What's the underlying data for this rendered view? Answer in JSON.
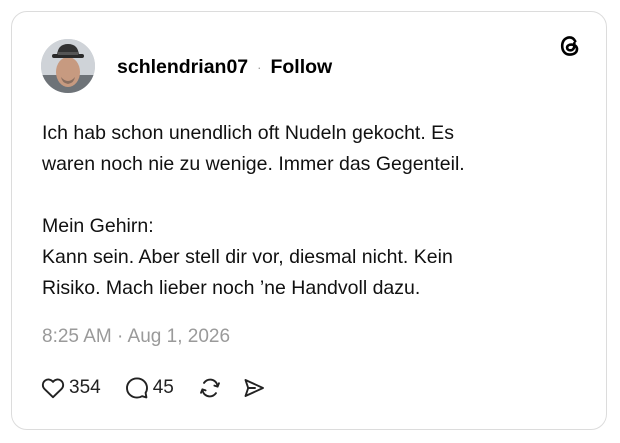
{
  "post": {
    "author": "schlendrian07",
    "separator": "·",
    "follow_label": "Follow",
    "body_lines": [
      "Ich hab schon unendlich oft Nudeln gekocht. Es",
      "waren noch nie zu wenige. Immer das Gegenteil.",
      "",
      "Mein Gehirn:",
      "Kann sein. Aber stell dir vor, diesmal nicht. Kein",
      "Risiko. Mach lieber noch ’ne Handvoll dazu."
    ],
    "timestamp": "8:25 AM · Aug 1, 2026",
    "likes": "354",
    "replies": "45"
  },
  "icons": {
    "brand": "threads-logo-icon",
    "like": "heart-icon",
    "reply": "speech-bubble-icon",
    "repost": "repost-icon",
    "share": "send-icon"
  },
  "colors": {
    "text": "#000000",
    "muted": "#9a9a9a",
    "border": "#dcdcdc"
  }
}
